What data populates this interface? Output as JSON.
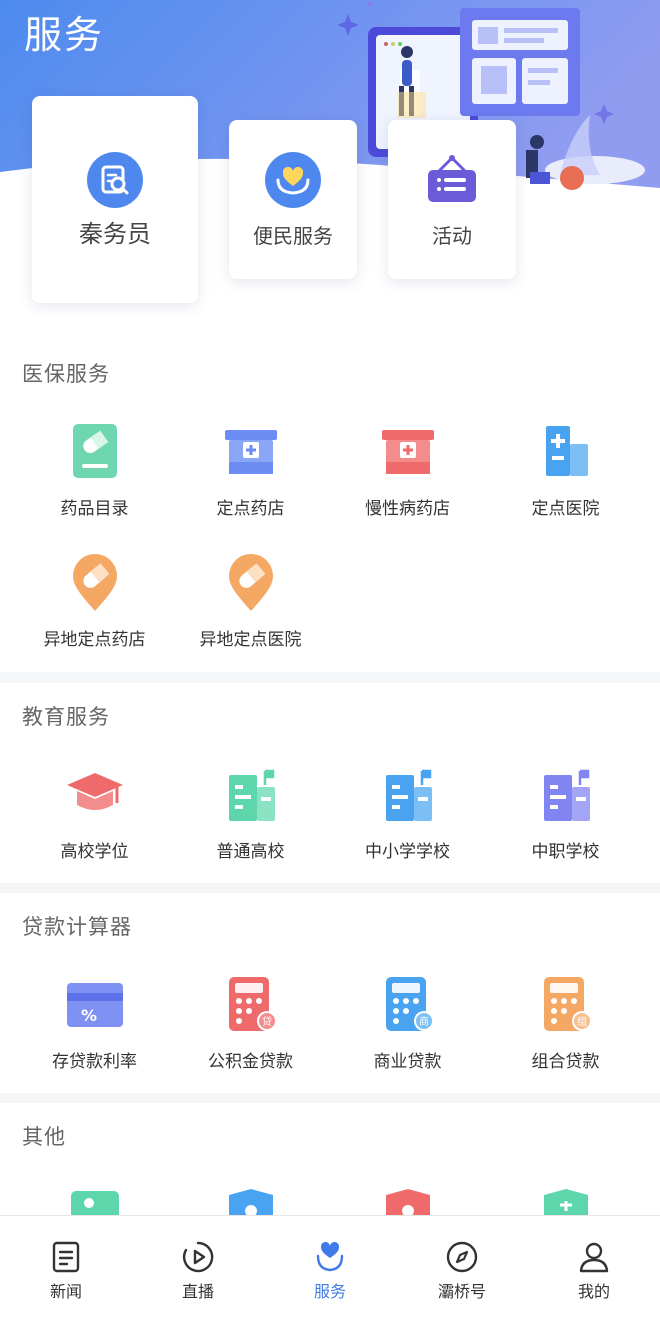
{
  "header": {
    "title": "服务",
    "cards": [
      {
        "label": "秦务员",
        "icon": "search-doc-icon"
      },
      {
        "label": "便民服务",
        "icon": "heart-hands-icon"
      },
      {
        "label": "活动",
        "icon": "signboard-icon"
      }
    ]
  },
  "sections": {
    "medical": {
      "title": "医保服务",
      "items": [
        {
          "label": "药品目录",
          "icon": "pill-card-icon"
        },
        {
          "label": "定点药店",
          "icon": "pharmacy-store-icon"
        },
        {
          "label": "慢性病药店",
          "icon": "pharmacy-store-red-icon"
        },
        {
          "label": "定点医院",
          "icon": "hospital-icon"
        },
        {
          "label": "异地定点药店",
          "icon": "pill-location-icon"
        },
        {
          "label": "异地定点医院",
          "icon": "pill-location-icon"
        }
      ]
    },
    "education": {
      "title": "教育服务",
      "items": [
        {
          "label": "高校学位",
          "icon": "graduation-cap-icon"
        },
        {
          "label": "普通高校",
          "icon": "school-building-icon"
        },
        {
          "label": "中小学学校",
          "icon": "school-building-icon"
        },
        {
          "label": "中职学校",
          "icon": "school-building-icon"
        }
      ]
    },
    "loan": {
      "title": "贷款计算器",
      "items": [
        {
          "label": "存贷款利率",
          "icon": "percent-card-icon"
        },
        {
          "label": "公积金贷款",
          "icon": "calculator-icon",
          "badge": "贷"
        },
        {
          "label": "商业贷款",
          "icon": "calculator-icon",
          "badge": "商"
        },
        {
          "label": "组合贷款",
          "icon": "calculator-icon",
          "badge": "组"
        }
      ]
    },
    "other": {
      "title": "其他"
    }
  },
  "tabbar": {
    "items": [
      {
        "label": "新闻",
        "icon": "news-icon"
      },
      {
        "label": "直播",
        "icon": "play-circle-icon"
      },
      {
        "label": "服务",
        "icon": "heart-person-icon",
        "active": true
      },
      {
        "label": "灞桥号",
        "icon": "compass-icon"
      },
      {
        "label": "我的",
        "icon": "user-icon"
      }
    ]
  },
  "colors": {
    "header_gradient_start": "#4f8ef0",
    "header_gradient_end": "#8e9bf0",
    "accent": "#3e7be8",
    "teal": "#5ed6ac",
    "blue": "#6a8cf3",
    "red": "#ef6b6b",
    "sky": "#4aa3f0",
    "orange": "#f4a863",
    "violet": "#8185f2"
  }
}
